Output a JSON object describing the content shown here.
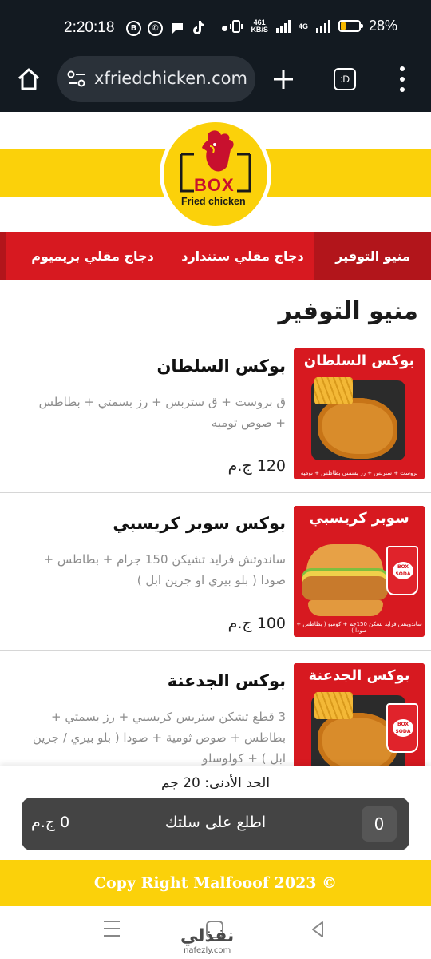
{
  "status_bar": {
    "time": "2:20:18",
    "net_speed_value": "461",
    "net_speed_unit": "KB/S",
    "network_type": "4G",
    "battery": "28%",
    "battery_level": 0.28
  },
  "browser": {
    "url": "xfriedchicken.com",
    "tab_count_label": ":D"
  },
  "brand": {
    "logo_word": "BOX",
    "logo_sub": "Fried chicken",
    "yellow": "#fbd10a",
    "red": "#d71920"
  },
  "categories": [
    {
      "label": "منيو التوفير",
      "active": true
    },
    {
      "label": "دجاج مقلي ستندارد",
      "active": false
    },
    {
      "label": "دجاج مقلي بريميوم",
      "active": false
    }
  ],
  "section_title": "منيو التوفير",
  "items": [
    {
      "name": "بوكس السلطان",
      "description": "ق بروست + ق ستربس + رز بسمتي + بطاطس + صوص توميه",
      "price": "120 ج.م",
      "image_banner": "بوكس السلطان",
      "image_caption": "بروست + ستربس + رز بسمتي بطاطس + توميه"
    },
    {
      "name": "بوكس سوبر كريسبي",
      "description": "ساندوتش فرايد تشيكن 150 جرام + بطاطس + صودا ( بلو بيري او جرين ابل )",
      "price": "100 ج.م",
      "image_banner": "سوبر كريسبي",
      "image_caption": "ساندويتش فرايد تشكن 150جم + كومبو ( بطاطس + صودا )"
    },
    {
      "name": "بوكس الجدعنة",
      "description": "3 قطع تشكن ستربس كريسبي + رز بسمتي + بطاطس + صوص ثومية + صودا ( بلو بيري / جرين ابل ) + كولوسلو",
      "price": "",
      "image_banner": "بوكس الجدعنة",
      "image_caption": ""
    }
  ],
  "cup_label": "BOX SODA",
  "cart": {
    "min_order": "الحد الأدنى: 20 جم",
    "count": "0",
    "cta": "اطلع على سلتك",
    "total": "0 ج.م"
  },
  "footer": {
    "copyright": "Copy Right Malfooof 2023 ©"
  },
  "watermark": {
    "arabic": "نفذلي",
    "latin": "nafezly.com"
  }
}
